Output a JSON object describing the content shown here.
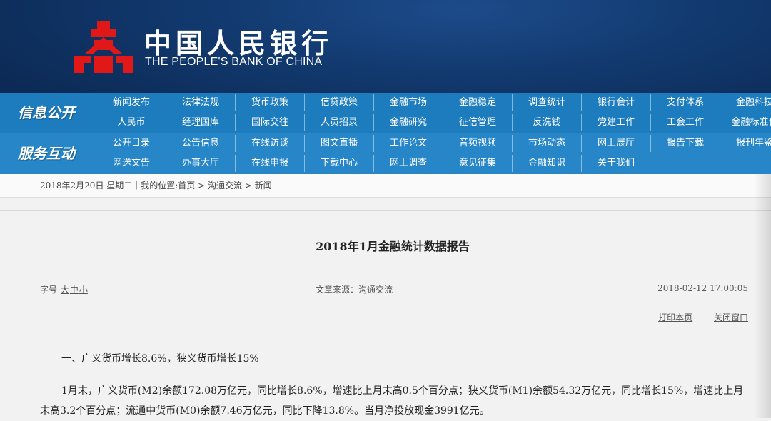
{
  "header": {
    "name_cn": "中国人民银行",
    "name_en": "THE PEOPLE'S BANK OF CHINA",
    "emblem_color": "#e01818"
  },
  "nav": {
    "band1": {
      "title": "信息公开",
      "upper": [
        "新闻发布",
        "法律法规",
        "货币政策",
        "信贷政策",
        "金融市场",
        "金融稳定",
        "调查统计",
        "银行会计",
        "支付体系",
        "金融科技"
      ],
      "lower": [
        "人民币",
        "经理国库",
        "国际交往",
        "人员招录",
        "金融研究",
        "征信管理",
        "反洗钱",
        "党建工作",
        "工会工作",
        "金融标准化"
      ]
    },
    "band2": {
      "title": "服务互动",
      "upper": [
        "公开目录",
        "公告信息",
        "在线访谈",
        "图文直播",
        "工作论文",
        "音频视频",
        "市场动态",
        "网上展厅",
        "报告下载",
        "报刊年鉴"
      ],
      "lower": [
        "网送文告",
        "办事大厅",
        "在线申报",
        "下载中心",
        "网上调查",
        "意见征集",
        "金融知识",
        "关于我们"
      ]
    }
  },
  "info_bar": {
    "text": "2018年2月20日 星期二｜我的位置:首页 > 沟通交流 > 新闻"
  },
  "article": {
    "title": "2018年1月金融统计数据报告",
    "font_size_label": "字号",
    "font_sizes": [
      "大",
      "中",
      "小"
    ],
    "source": "文章来源：沟通交流",
    "date": "2018-02-12 17:00:05",
    "print_label": "打印本页",
    "close_label": "关闭窗口",
    "section_heading": "一、广义货币增长8.6%，狭义货币增长15%",
    "paragraph": "1月末，广义货币(M2)余额172.08万亿元，同比增长8.6%，增速比上月末高0.5个百分点；狭义货币(M1)余额54.32万亿元，同比增长15%，增速比上月末高3.2个百分点；流通中货币(M0)余额7.46万亿元，同比下降13.8%。当月净投放现金3991亿元。"
  }
}
